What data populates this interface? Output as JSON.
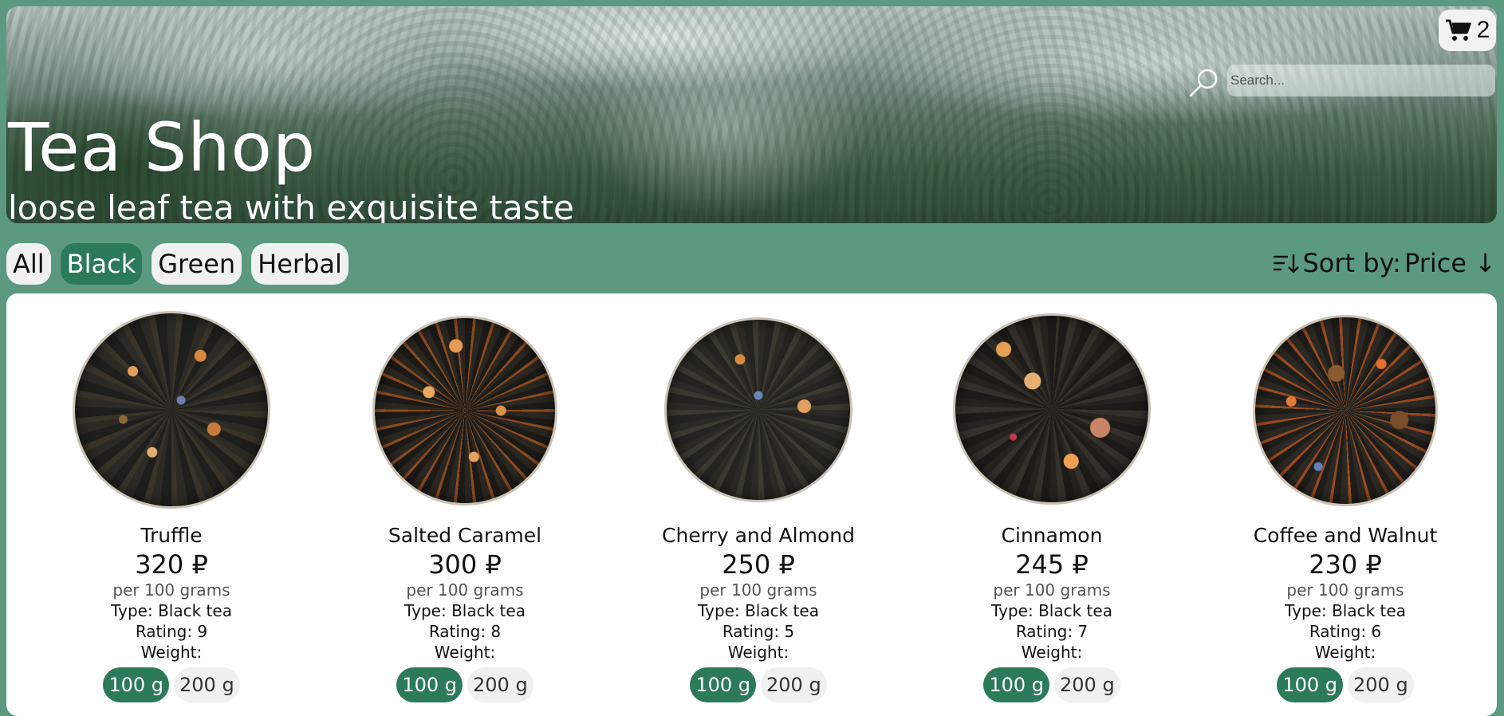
{
  "hero": {
    "title": "Tea Shop",
    "subtitle": "loose leaf tea with exquisite taste",
    "background": "misty mountain forest"
  },
  "cart": {
    "icon": "cart-icon",
    "count": "2"
  },
  "search": {
    "icon": "search-icon",
    "placeholder": "Search..."
  },
  "filters": {
    "all": "All",
    "black": "Black",
    "green": "Green",
    "herbal": "Herbal",
    "active": "Black"
  },
  "sort": {
    "icon": "sort-icon",
    "label": "Sort by:",
    "value": "Price ↓"
  },
  "colors": {
    "accent": "#2b7a58",
    "background": "#5b9a7f",
    "chip": "#f1f1f1"
  },
  "products": [
    {
      "name": "Truffle",
      "price": "320 ₽",
      "unit": "per 100 grams",
      "type": "Type: Black tea",
      "rating": "Rating: 9",
      "weight_label": "Weight:",
      "weights": [
        "100 g",
        "200 g"
      ],
      "selected": "100 g"
    },
    {
      "name": "Salted Caramel",
      "price": "300 ₽",
      "unit": "per 100 grams",
      "type": "Type: Black tea",
      "rating": "Rating: 8",
      "weight_label": "Weight:",
      "weights": [
        "100 g",
        "200 g"
      ],
      "selected": "100 g"
    },
    {
      "name": "Cherry and Almond",
      "price": "250 ₽",
      "unit": "per 100 grams",
      "type": "Type: Black tea",
      "rating": "Rating: 5",
      "weight_label": "Weight:",
      "weights": [
        "100 g",
        "200 g"
      ],
      "selected": "100 g"
    },
    {
      "name": "Cinnamon",
      "price": "245 ₽",
      "unit": "per 100 grams",
      "type": "Type: Black tea",
      "rating": "Rating: 7",
      "weight_label": "Weight:",
      "weights": [
        "100 g",
        "200 g"
      ],
      "selected": "100 g"
    },
    {
      "name": "Coffee and Walnut",
      "price": "230 ₽",
      "unit": "per 100 grams",
      "type": "Type: Black tea",
      "rating": "Rating: 6",
      "weight_label": "Weight:",
      "weights": [
        "100 g",
        "200 g"
      ],
      "selected": "100 g"
    }
  ]
}
